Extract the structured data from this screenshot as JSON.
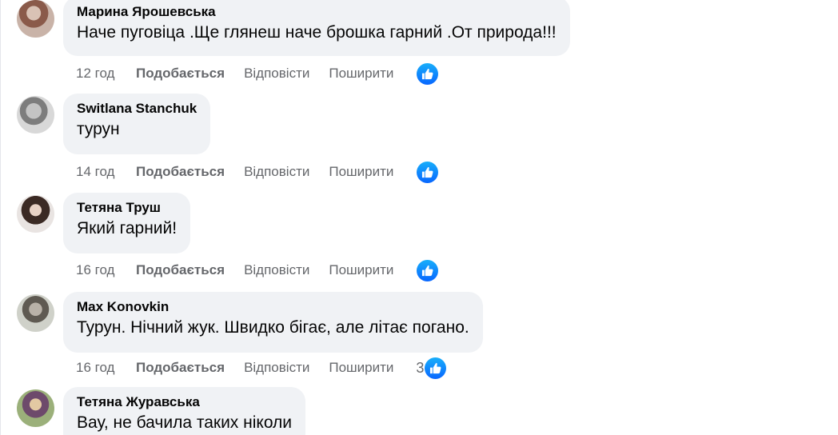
{
  "colors": {
    "bubble_bg": "#f0f2f5",
    "like_blue": "#0866ff",
    "meta_text": "#65676b"
  },
  "actions": {
    "like_label": "Подобається",
    "reply_label": "Відповісти",
    "share_label": "Поширити"
  },
  "comments": [
    {
      "author": "Марина Ярошевська",
      "text": "Наче пуговіца .Ще глянеш наче брошка гарний .От природа!!!",
      "time": "12 год",
      "like_count": "",
      "icon": "like-reaction-icon"
    },
    {
      "author": "Switlana Stanchuk",
      "text": "турун",
      "time": "14 год",
      "like_count": "",
      "icon": "like-reaction-icon"
    },
    {
      "author": "Тетяна Труш",
      "text": "Який гарний!",
      "time": "16 год",
      "like_count": "",
      "icon": "like-reaction-icon"
    },
    {
      "author": "Max Konovkin",
      "text": "Турун. Нічний жук. Швидко бігає, але літає погано.",
      "time": "16 год",
      "like_count": "3",
      "icon": "like-reaction-icon"
    },
    {
      "author": "Тетяна Журавська",
      "text": "Вау, не бачила таких ніколи",
      "time": "",
      "like_count": "",
      "icon": ""
    }
  ]
}
